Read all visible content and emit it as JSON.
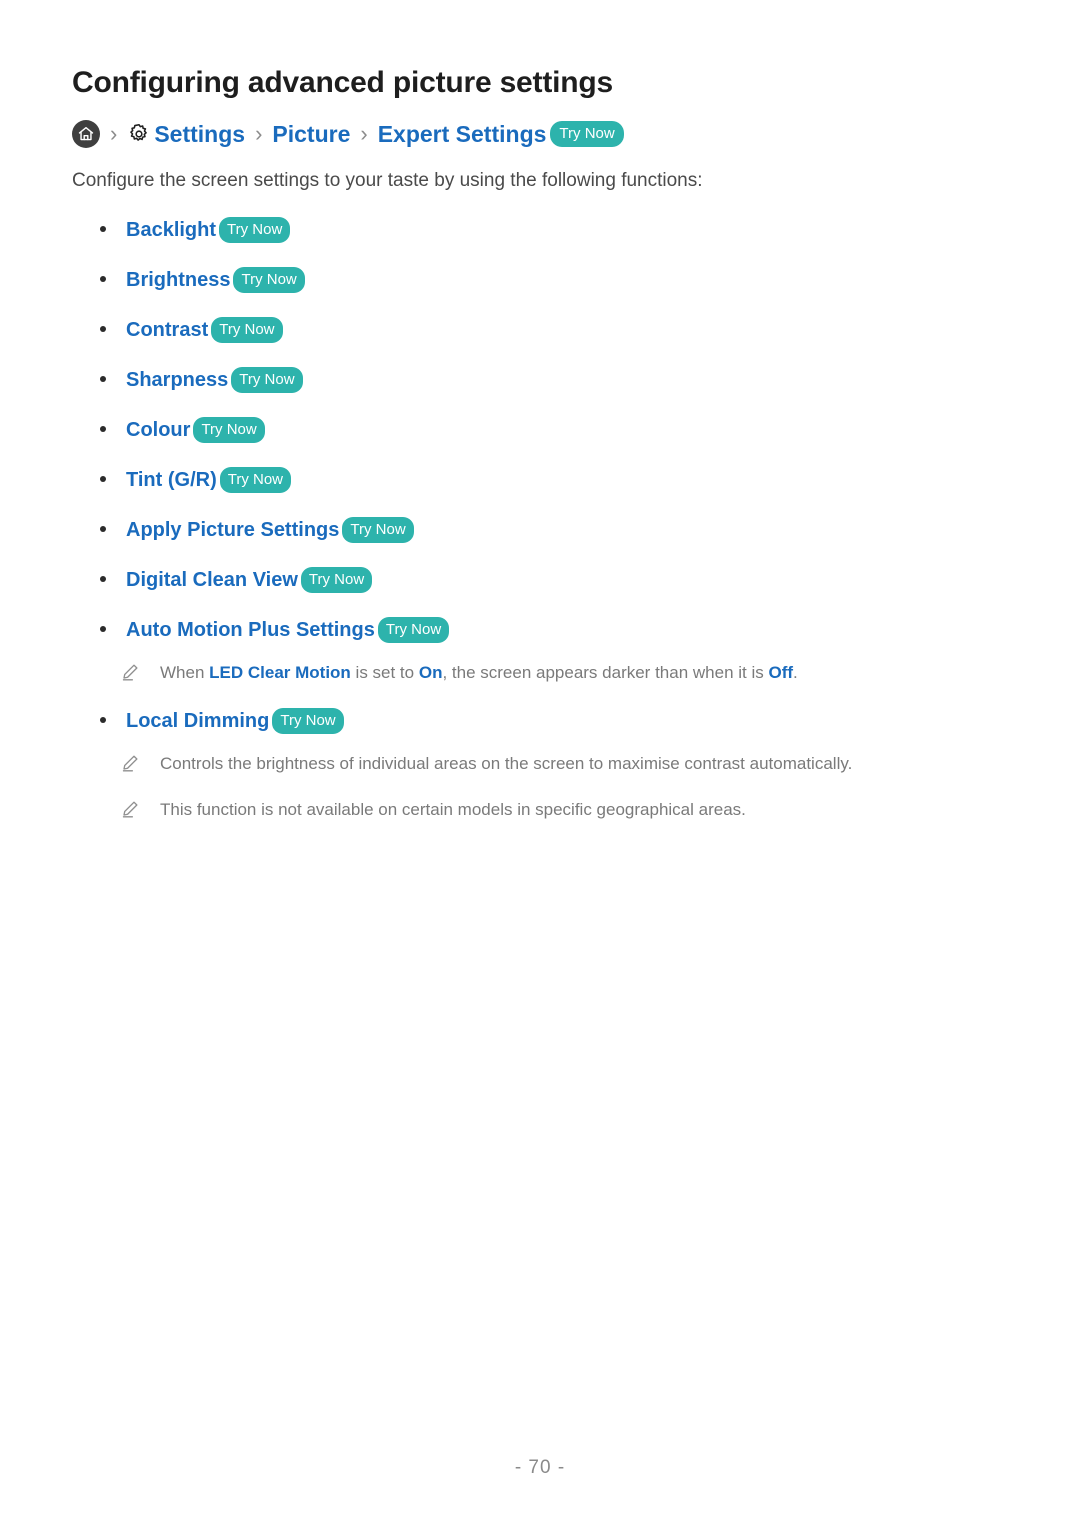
{
  "document": {
    "title": "Configuring advanced picture settings",
    "intro": "Configure the screen settings to your taste by using the following functions:",
    "page_number": "- 70 -"
  },
  "breadcrumb": {
    "home_icon": "home-icon",
    "gear_icon": "gear-icon",
    "separator": "›",
    "items": [
      {
        "label": "Settings"
      },
      {
        "label": "Picture"
      },
      {
        "label": "Expert Settings"
      }
    ],
    "try_now": "Try Now"
  },
  "badges": {
    "try_now": "Try Now",
    "try_now_color": "#2db3ac"
  },
  "colors": {
    "link": "#1a6bbd",
    "title": "#1e1e1e",
    "body": "#4a4a4a",
    "note": "#7a7a7a",
    "bullet": "#2b2b2b",
    "home_circle": "#3f3f3f"
  },
  "features": [
    {
      "label": "Backlight",
      "try_now": "Try Now"
    },
    {
      "label": "Brightness",
      "try_now": "Try Now"
    },
    {
      "label": "Contrast",
      "try_now": "Try Now"
    },
    {
      "label": "Sharpness",
      "try_now": "Try Now"
    },
    {
      "label": "Colour",
      "try_now": "Try Now"
    },
    {
      "label": "Tint (G/R)",
      "try_now": "Try Now"
    },
    {
      "label": "Apply Picture Settings",
      "try_now": "Try Now"
    },
    {
      "label": "Digital Clean View",
      "try_now": "Try Now"
    },
    {
      "label": "Auto Motion Plus Settings",
      "try_now": "Try Now"
    },
    {
      "label": "Local Dimming",
      "try_now": "Try Now"
    }
  ],
  "notes": {
    "auto_motion": {
      "icon": "pencil-icon",
      "part1": "When ",
      "em1": "LED Clear Motion",
      "part2": " is set to ",
      "em2": "On",
      "part3": ", the screen appears darker than when it is ",
      "em3": "Off",
      "part4": "."
    },
    "local_dimming_1": {
      "icon": "pencil-icon",
      "text": "Controls the brightness of individual areas on the screen to maximise contrast automatically."
    },
    "local_dimming_2": {
      "icon": "pencil-icon",
      "text": "This function is not available on certain models in specific geographical areas."
    }
  }
}
